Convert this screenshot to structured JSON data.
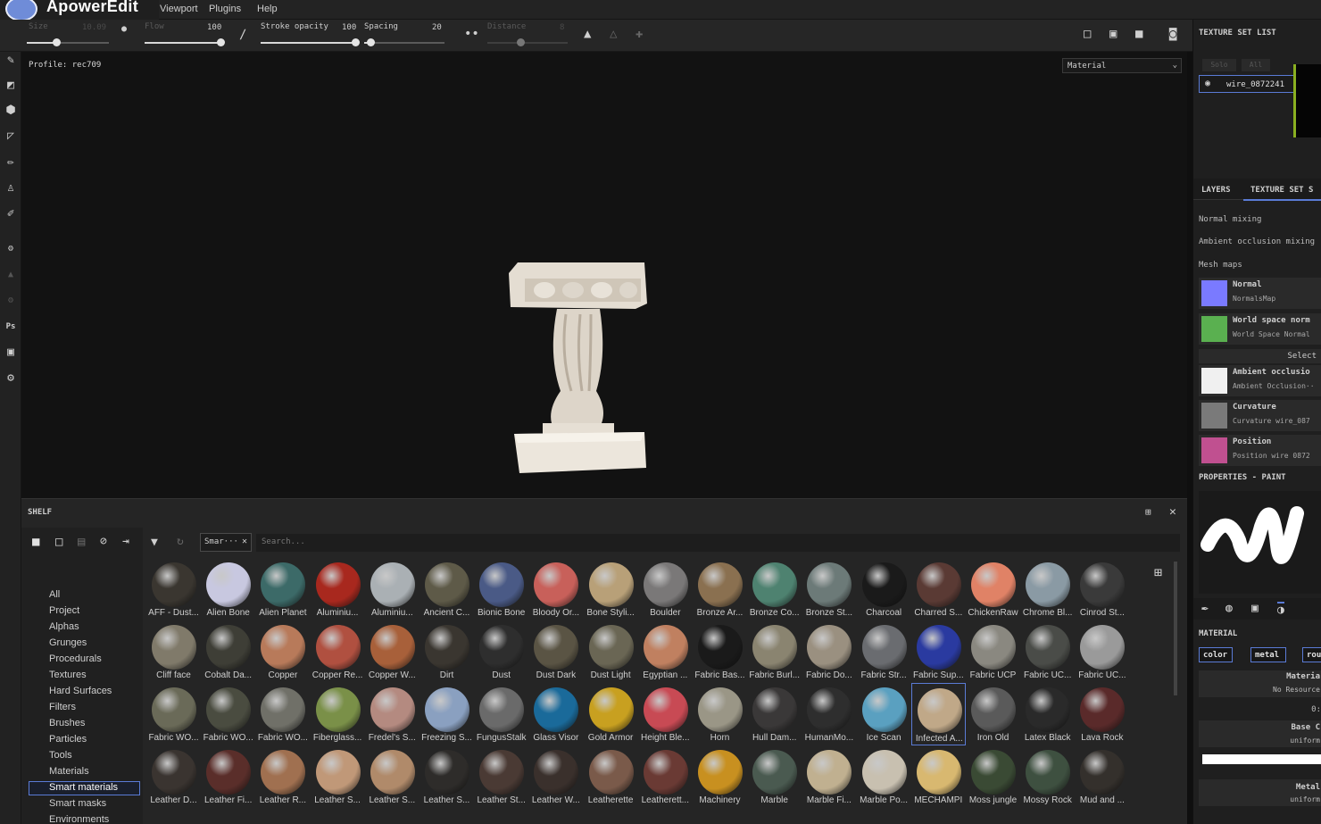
{
  "app": {
    "name": "ApowerEdit"
  },
  "menu": [
    "Viewport",
    "Plugins",
    "Help"
  ],
  "toolbar": {
    "size_label": "Size",
    "size_value": "10.09",
    "flow_label": "Flow",
    "flow_value": "100",
    "stroke_opacity_label": "Stroke opacity",
    "stroke_opacity_value": "100",
    "spacing_label": "Spacing",
    "spacing_value": "20",
    "distance_label": "Distance",
    "distance_value": "8"
  },
  "viewport": {
    "profile": "Profile: rec709",
    "view_mode": "Material"
  },
  "shelf": {
    "title": "SHELF",
    "filter_chip": "Smar···",
    "search_placeholder": "Search...",
    "categories": [
      "All",
      "Project",
      "Alphas",
      "Grunges",
      "Procedurals",
      "Textures",
      "Hard Surfaces",
      "Filters",
      "Brushes",
      "Particles",
      "Tools",
      "Materials",
      "Smart materials",
      "Smart masks",
      "Environments",
      "Color profiles"
    ],
    "selected_category": "Smart materials",
    "materials": [
      {
        "name": "AFF - Dust...",
        "color": "#3a3630"
      },
      {
        "name": "Alien Bone",
        "color": "#c8c8e0"
      },
      {
        "name": "Alien Planet",
        "color": "#3c6a68"
      },
      {
        "name": "Aluminiu...",
        "color": "#a8281e"
      },
      {
        "name": "Aluminiu...",
        "color": "#aab0b4"
      },
      {
        "name": "Ancient C...",
        "color": "#5e5a48"
      },
      {
        "name": "Bionic Bone",
        "color": "#4a5a86"
      },
      {
        "name": "Bloody Or...",
        "color": "#c8605a"
      },
      {
        "name": "Bone Styli...",
        "color": "#b8a078"
      },
      {
        "name": "Boulder",
        "color": "#7a7878"
      },
      {
        "name": "Bronze Ar...",
        "color": "#8a7050"
      },
      {
        "name": "Bronze Co...",
        "color": "#4e8270"
      },
      {
        "name": "Bronze St...",
        "color": "#6c7a78"
      },
      {
        "name": "Charcoal",
        "color": "#1a1a1a"
      },
      {
        "name": "Charred S...",
        "color": "#5a3a34"
      },
      {
        "name": "ChickenRaw",
        "color": "#e08266"
      },
      {
        "name": "Chrome Bl...",
        "color": "#8a9aa4"
      },
      {
        "name": "Cinrod St...",
        "color": "#3a3a3a"
      },
      {
        "name": "Cliff face",
        "color": "#807a6a"
      },
      {
        "name": "Cobalt Da...",
        "color": "#3e3e36"
      },
      {
        "name": "Copper",
        "color": "#b87a5a"
      },
      {
        "name": "Copper Re...",
        "color": "#b05040"
      },
      {
        "name": "Copper W...",
        "color": "#a8603a"
      },
      {
        "name": "Dirt",
        "color": "#3a3630"
      },
      {
        "name": "Dust",
        "color": "#2e2e2e"
      },
      {
        "name": "Dust Dark",
        "color": "#5a5444"
      },
      {
        "name": "Dust Light",
        "color": "#6a6654"
      },
      {
        "name": "Egyptian ...",
        "color": "#c08060"
      },
      {
        "name": "Fabric Bas...",
        "color": "#1a1a1a"
      },
      {
        "name": "Fabric Burl...",
        "color": "#8a8470"
      },
      {
        "name": "Fabric Do...",
        "color": "#9a9080"
      },
      {
        "name": "Fabric Str...",
        "color": "#6a6c70"
      },
      {
        "name": "Fabric Sup...",
        "color": "#2a3aa0"
      },
      {
        "name": "Fabric UCP",
        "color": "#8a8880"
      },
      {
        "name": "Fabric UC...",
        "color": "#4a4c48"
      },
      {
        "name": "Fabric UC...",
        "color": "#9a9a9a"
      },
      {
        "name": "Fabric WO...",
        "color": "#6a6a58"
      },
      {
        "name": "Fabric WO...",
        "color": "#4a4c40"
      },
      {
        "name": "Fabric WO...",
        "color": "#707068"
      },
      {
        "name": "Fiberglass...",
        "color": "#7a9048"
      },
      {
        "name": "Fredel's S...",
        "color": "#b48a80"
      },
      {
        "name": "Freezing S...",
        "color": "#8aa0c0"
      },
      {
        "name": "FungusStalk",
        "color": "#6a6a6a"
      },
      {
        "name": "Glass Visor",
        "color": "#1a6a9a"
      },
      {
        "name": "Gold Armor",
        "color": "#c8a020"
      },
      {
        "name": "Height Ble...",
        "color": "#c84a54"
      },
      {
        "name": "Horn",
        "color": "#9a9686"
      },
      {
        "name": "Hull Dam...",
        "color": "#3a3838"
      },
      {
        "name": "HumanMo...",
        "color": "#2e2e2e"
      },
      {
        "name": "Ice Scan",
        "color": "#5aa0c0"
      },
      {
        "name": "Infected A...",
        "color": "#c0a888"
      },
      {
        "name": "Iron Old",
        "color": "#5a5a5a"
      },
      {
        "name": "Latex Black",
        "color": "#2a2a2a"
      },
      {
        "name": "Lava Rock",
        "color": "#5a2a2a"
      },
      {
        "name": "Leather D...",
        "color": "#3a3430"
      },
      {
        "name": "Leather Fi...",
        "color": "#5a2e2a"
      },
      {
        "name": "Leather R...",
        "color": "#a07050"
      },
      {
        "name": "Leather S...",
        "color": "#c09878"
      },
      {
        "name": "Leather S...",
        "color": "#b08a6a"
      },
      {
        "name": "Leather S...",
        "color": "#2e2c2a"
      },
      {
        "name": "Leather St...",
        "color": "#4a3a34"
      },
      {
        "name": "Leather W...",
        "color": "#3a302c"
      },
      {
        "name": "Leatherette",
        "color": "#7a5a4a"
      },
      {
        "name": "Leatherett...",
        "color": "#6a3a34"
      },
      {
        "name": "Machinery",
        "color": "#c89020"
      },
      {
        "name": "Marble",
        "color": "#4a5a50"
      },
      {
        "name": "Marble Fi...",
        "color": "#c0b090"
      },
      {
        "name": "Marble Po...",
        "color": "#c8c0b0"
      },
      {
        "name": "MECHAMPI",
        "color": "#d8b870"
      },
      {
        "name": "Moss jungle",
        "color": "#3a4a34"
      },
      {
        "name": "Mossy Rock",
        "color": "#3e5040"
      },
      {
        "name": "Mud and ...",
        "color": "#34302c"
      }
    ],
    "selected_material": "Infected A..."
  },
  "right_panel": {
    "texture_set_list_title": "TEXTURE SET LIST",
    "solo_label": "Solo",
    "all_label": "All",
    "texture_set_name": "wire_0872241",
    "tabs": [
      "LAYERS",
      "TEXTURE SET S"
    ],
    "normal_mixing": "Normal mixing",
    "ao_mixing": "Ambient occlusion mixing",
    "mesh_maps_label": "Mesh maps",
    "mesh_maps": [
      {
        "title": "Normal",
        "sub": "NormalsMap",
        "color": "#7a7aff"
      },
      {
        "title": "World space norm",
        "sub": "World Space Normal",
        "color": "#5ab050"
      },
      {
        "title": "Ambient occlusio",
        "sub": "Ambient Occlusion··",
        "color": "#f0f0f0"
      },
      {
        "title": "Curvature",
        "sub": "Curvature wire_087",
        "color": "#7a7a7a"
      },
      {
        "title": "Position",
        "sub": "Position wire 0872",
        "color": "#c05090"
      }
    ],
    "select_label": "Select",
    "properties_title": "PROPERTIES - PAINT",
    "material_title": "MATERIAL",
    "material_channels": [
      "color",
      "metal",
      "rou"
    ],
    "material_row_title": "Materia",
    "material_row_value": "No Resource",
    "zero_label": "0:",
    "base_color_title": "Base C",
    "base_color_value": "uniform",
    "metal_title": "Metal",
    "metal_value": "uniform"
  },
  "colors": {
    "accent": "#5a7bd6"
  }
}
